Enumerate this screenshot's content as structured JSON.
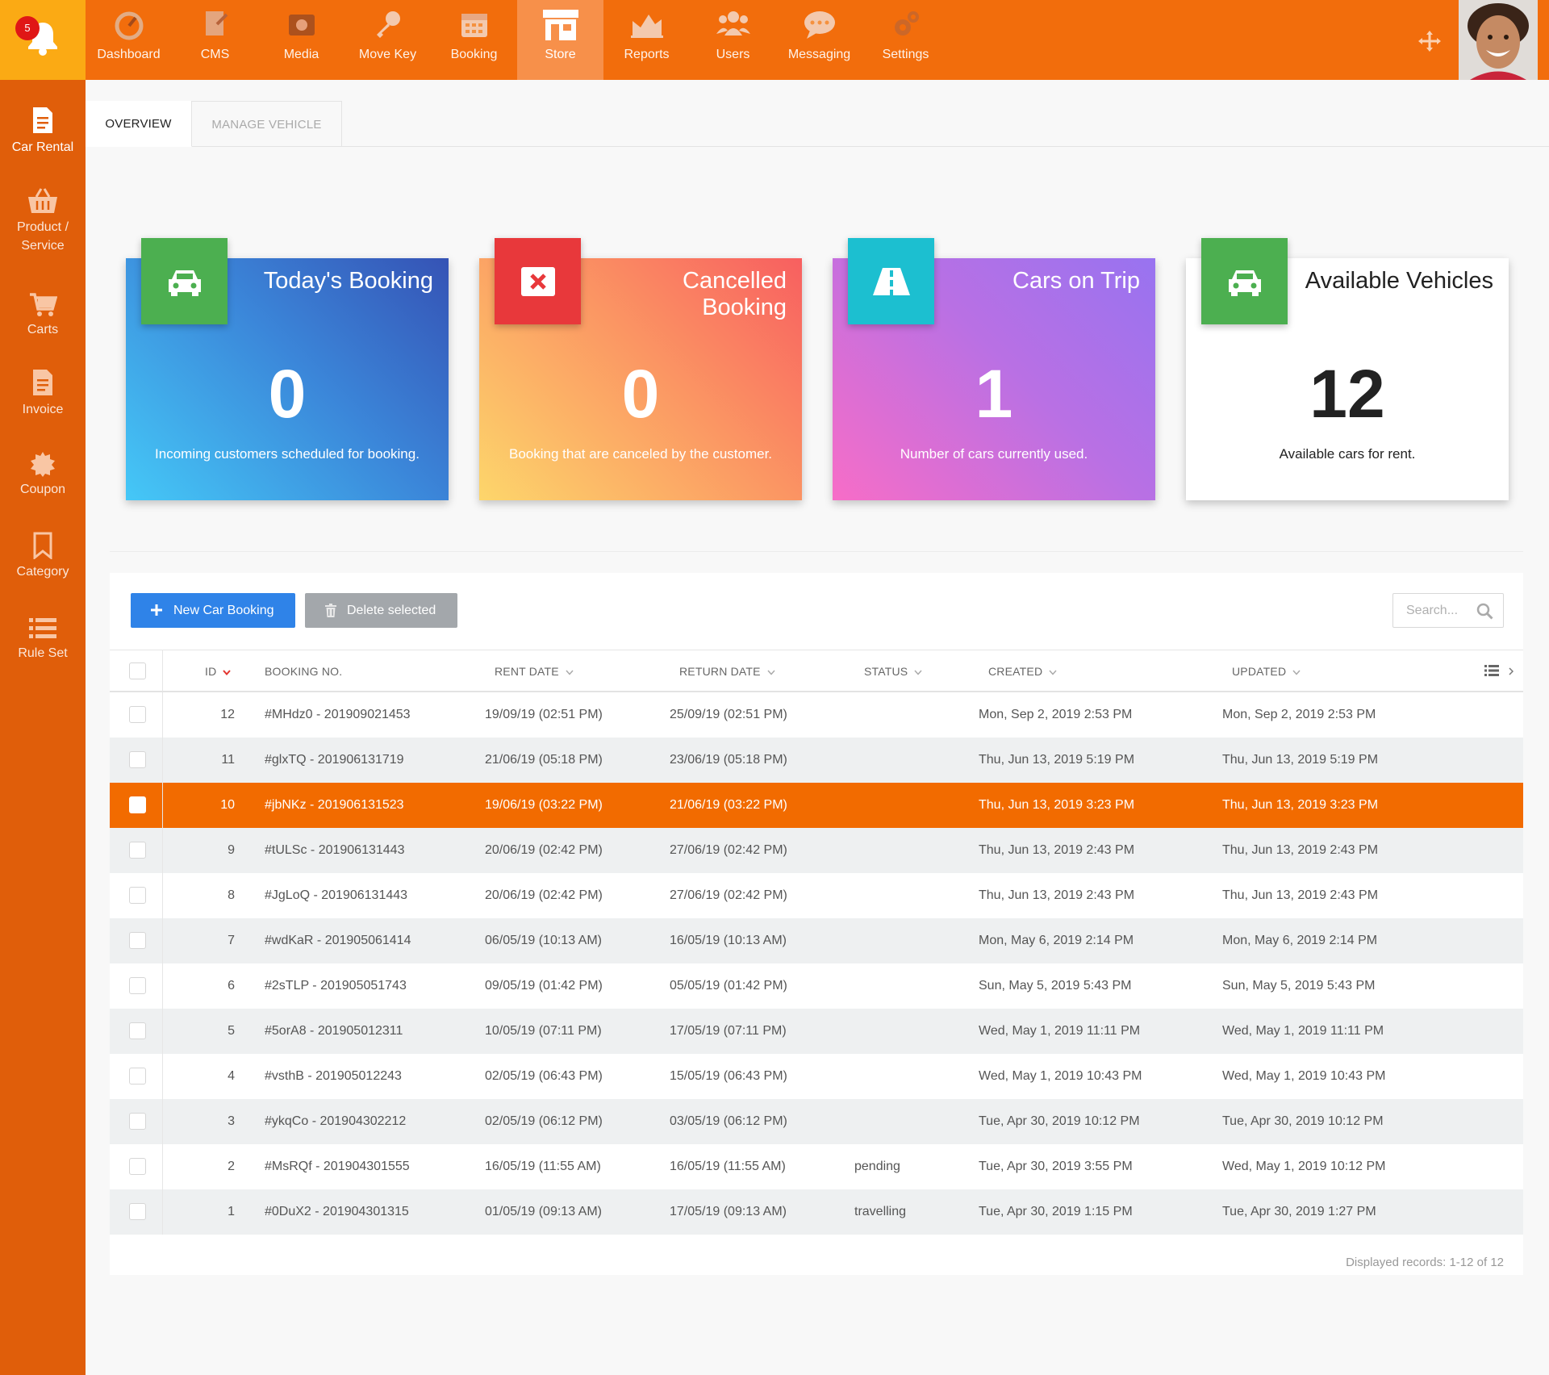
{
  "notifications": {
    "count": "5"
  },
  "nav": [
    {
      "label": "Dashboard",
      "icon": "dashboard-icon"
    },
    {
      "label": "CMS",
      "icon": "cms-icon"
    },
    {
      "label": "Media",
      "icon": "media-icon"
    },
    {
      "label": "Move Key",
      "icon": "key-icon"
    },
    {
      "label": "Booking",
      "icon": "calendar-icon"
    },
    {
      "label": "Store",
      "icon": "store-icon",
      "active": true
    },
    {
      "label": "Reports",
      "icon": "chart-icon"
    },
    {
      "label": "Users",
      "icon": "users-icon"
    },
    {
      "label": "Messaging",
      "icon": "chat-icon"
    },
    {
      "label": "Settings",
      "icon": "gear-icon"
    }
  ],
  "sidebar": [
    {
      "label": "Car Rental",
      "icon": "document-icon",
      "active": true
    },
    {
      "label": "Product / Service",
      "icon": "basket-icon"
    },
    {
      "label": "Carts",
      "icon": "cart-icon"
    },
    {
      "label": "Invoice",
      "icon": "invoice-icon"
    },
    {
      "label": "Coupon",
      "icon": "badge-icon"
    },
    {
      "label": "Category",
      "icon": "bookmark-icon"
    },
    {
      "label": "Rule Set",
      "icon": "list-icon"
    }
  ],
  "tabs": {
    "overview": "OVERVIEW",
    "manage": "MANAGE VEHICLE"
  },
  "cards": [
    {
      "title": "Today's Booking",
      "value": "0",
      "desc": "Incoming customers scheduled for booking.",
      "icon": "car-icon",
      "icon_color": "#4caf50"
    },
    {
      "title": "Cancelled Booking",
      "value": "0",
      "desc": "Booking that are canceled by the customer.",
      "icon": "cancel-icon",
      "icon_color": "#e8383b"
    },
    {
      "title": "Cars on Trip",
      "value": "1",
      "desc": "Number of cars currently used.",
      "icon": "road-icon",
      "icon_color": "#1cbfd0"
    },
    {
      "title": "Available Vehicles",
      "value": "12",
      "desc": "Available cars for rent.",
      "icon": "car-icon",
      "icon_color": "#4caf50"
    }
  ],
  "toolbar": {
    "new_label": "New Car Booking",
    "delete_label": "Delete selected",
    "search_placeholder": "Search..."
  },
  "table": {
    "columns": [
      "ID",
      "BOOKING NO.",
      "RENT DATE",
      "RETURN DATE",
      "STATUS",
      "CREATED",
      "UPDATED"
    ],
    "rows": [
      {
        "id": "12",
        "booking": "#MHdz0 - 201909021453",
        "rent": "19/09/19 (02:51 PM)",
        "ret": "25/09/19 (02:51 PM)",
        "status": "",
        "created": "Mon, Sep 2, 2019 2:53 PM",
        "updated": "Mon, Sep 2, 2019 2:53 PM"
      },
      {
        "id": "11",
        "booking": "#glxTQ - 201906131719",
        "rent": "21/06/19 (05:18 PM)",
        "ret": "23/06/19 (05:18 PM)",
        "status": "",
        "created": "Thu, Jun 13, 2019 5:19 PM",
        "updated": "Thu, Jun 13, 2019 5:19 PM"
      },
      {
        "id": "10",
        "booking": "#jbNKz - 201906131523",
        "rent": "19/06/19 (03:22 PM)",
        "ret": "21/06/19 (03:22 PM)",
        "status": "",
        "created": "Thu, Jun 13, 2019 3:23 PM",
        "updated": "Thu, Jun 13, 2019 3:23 PM",
        "selected": true
      },
      {
        "id": "9",
        "booking": "#tULSc - 201906131443",
        "rent": "20/06/19 (02:42 PM)",
        "ret": "27/06/19 (02:42 PM)",
        "status": "",
        "created": "Thu, Jun 13, 2019 2:43 PM",
        "updated": "Thu, Jun 13, 2019 2:43 PM"
      },
      {
        "id": "8",
        "booking": "#JgLoQ - 201906131443",
        "rent": "20/06/19 (02:42 PM)",
        "ret": "27/06/19 (02:42 PM)",
        "status": "",
        "created": "Thu, Jun 13, 2019 2:43 PM",
        "updated": "Thu, Jun 13, 2019 2:43 PM"
      },
      {
        "id": "7",
        "booking": "#wdKaR - 201905061414",
        "rent": "06/05/19 (10:13 AM)",
        "ret": "16/05/19 (10:13 AM)",
        "status": "",
        "created": "Mon, May 6, 2019 2:14 PM",
        "updated": "Mon, May 6, 2019 2:14 PM"
      },
      {
        "id": "6",
        "booking": "#2sTLP - 201905051743",
        "rent": "09/05/19 (01:42 PM)",
        "ret": "05/05/19 (01:42 PM)",
        "status": "",
        "created": "Sun, May 5, 2019 5:43 PM",
        "updated": "Sun, May 5, 2019 5:43 PM"
      },
      {
        "id": "5",
        "booking": "#5orA8 - 201905012311",
        "rent": "10/05/19 (07:11 PM)",
        "ret": "17/05/19 (07:11 PM)",
        "status": "",
        "created": "Wed, May 1, 2019 11:11 PM",
        "updated": "Wed, May 1, 2019 11:11 PM"
      },
      {
        "id": "4",
        "booking": "#vsthB - 201905012243",
        "rent": "02/05/19 (06:43 PM)",
        "ret": "15/05/19 (06:43 PM)",
        "status": "",
        "created": "Wed, May 1, 2019 10:43 PM",
        "updated": "Wed, May 1, 2019 10:43 PM"
      },
      {
        "id": "3",
        "booking": "#ykqCo - 201904302212",
        "rent": "02/05/19 (06:12 PM)",
        "ret": "03/05/19 (06:12 PM)",
        "status": "",
        "created": "Tue, Apr 30, 2019 10:12 PM",
        "updated": "Tue, Apr 30, 2019 10:12 PM"
      },
      {
        "id": "2",
        "booking": "#MsRQf - 201904301555",
        "rent": "16/05/19 (11:55 AM)",
        "ret": "16/05/19 (11:55 AM)",
        "status": "pending",
        "created": "Tue, Apr 30, 2019 3:55 PM",
        "updated": "Wed, May 1, 2019 10:12 PM"
      },
      {
        "id": "1",
        "booking": "#0DuX2 - 201904301315",
        "rent": "01/05/19 (09:13 AM)",
        "ret": "17/05/19 (09:13 AM)",
        "status": "travelling",
        "created": "Tue, Apr 30, 2019 1:15 PM",
        "updated": "Tue, Apr 30, 2019 1:27 PM"
      }
    ]
  },
  "footer": {
    "records": "Displayed records: 1-12 of 12"
  }
}
